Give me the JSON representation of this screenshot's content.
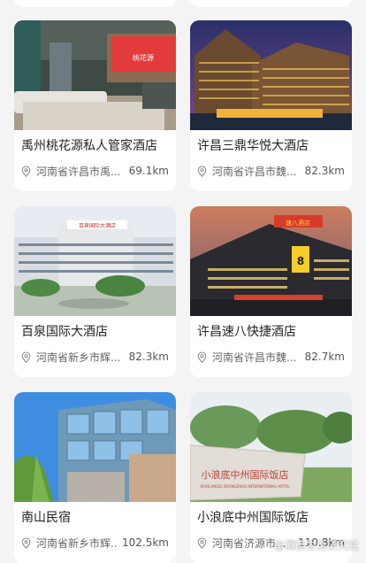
{
  "hotels": [
    {
      "name": "禹州桃花源私人管家酒店",
      "address": "河南省许昌市禹...",
      "distance": "69.1km",
      "photo_sign": "桃花源",
      "icon": "location-pin-icon"
    },
    {
      "name": "许昌三鼎华悦大酒店",
      "address": "河南省许昌市魏...",
      "distance": "82.3km",
      "icon": "location-pin-icon"
    },
    {
      "name": "百泉国际大酒店",
      "address": "河南省新乡市辉...",
      "distance": "82.3km",
      "photo_sign": "百泉国际大酒店",
      "icon": "location-pin-icon"
    },
    {
      "name": "许昌速八快捷酒店",
      "address": "河南省许昌市魏...",
      "distance": "82.7km",
      "photo_sign": "速八酒店",
      "icon": "location-pin-icon"
    },
    {
      "name": "南山民宿",
      "address": "河南省新乡市辉...",
      "distance": "102.5km",
      "icon": "location-pin-icon"
    },
    {
      "name": "小浪底中州国际饭店",
      "address": "河南省济源市...",
      "distance": "110.8km",
      "photo_sign": "小浪底中州国际饭店",
      "photo_sign_pinyin": "XIAOLANGDI ZHONGZHOU INTERNATIONAL HOTEL",
      "icon": "location-pin-icon"
    }
  ],
  "watermark": "@酒店生活研究社",
  "colors": {
    "background": "#f4f4f5",
    "card": "#ffffff",
    "title": "#222222",
    "meta": "#666666"
  }
}
